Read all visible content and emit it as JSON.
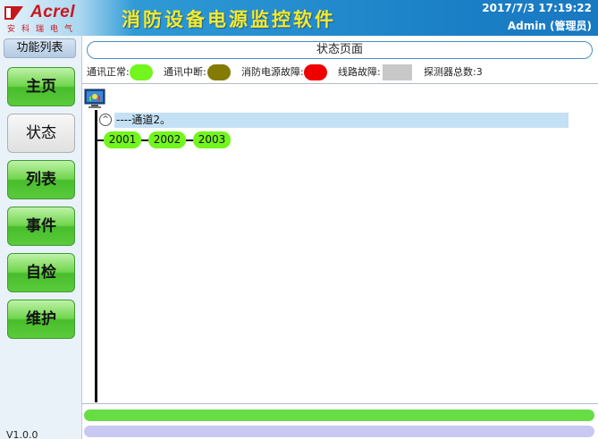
{
  "header": {
    "logo_name": "Acrel",
    "logo_sub": "安科瑞电气",
    "title": "消防设备电源监控软件",
    "datetime": "2017/7/3 17:19:22",
    "user": "Admin (管理员)"
  },
  "sidebar": {
    "title": "功能列表",
    "items": [
      {
        "label": "主页",
        "icon": "none"
      },
      {
        "label": "状态",
        "icon": "none",
        "active": true
      },
      {
        "label": "列表",
        "icon": "none"
      },
      {
        "label": "事件",
        "icon": "none"
      },
      {
        "label": "自检",
        "icon": "none"
      },
      {
        "label": "维护",
        "icon": "none"
      }
    ],
    "version": "V1.0.0"
  },
  "page": {
    "title": "状态页面"
  },
  "legend": {
    "normal": {
      "label": "通讯正常:",
      "color": "#73f51e"
    },
    "interrupt": {
      "label": "通讯中断:",
      "color": "#847b05"
    },
    "power_fault": {
      "label": "消防电源故障:",
      "color": "#f00000"
    },
    "line_fault": {
      "label": "线路故障:",
      "color": "#c8c8c8"
    },
    "detector_total": "探测器总数:3"
  },
  "tree": {
    "monitor_icon": "monitor-icon",
    "toggle_symbol": "^",
    "channel_label": "----通道2。",
    "nodes": [
      "2001",
      "2002",
      "2003"
    ]
  },
  "colors": {
    "status_green": "#73f51e",
    "bar_green": "#66dd44",
    "bar_purple": "#c8c8f2",
    "header_blue": "#1a7fc6",
    "title_yellow": "#f6ea2a"
  }
}
